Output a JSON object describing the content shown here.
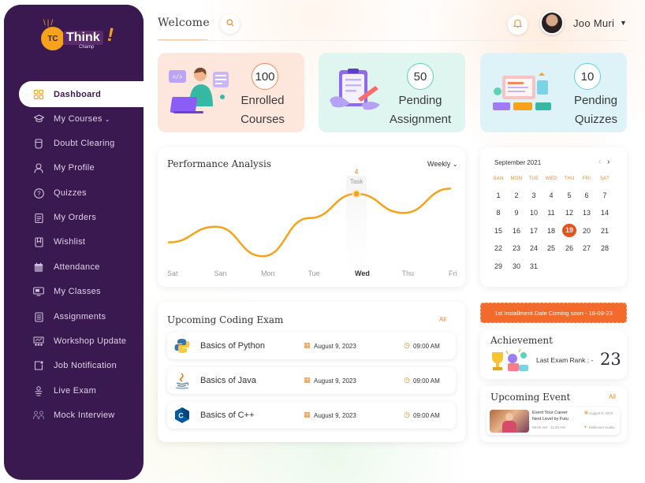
{
  "brand": {
    "logo_badge": "TC",
    "logo_name": "Think",
    "logo_sub": "Champ",
    "logo_mark": "!"
  },
  "sidebar": {
    "items": [
      {
        "label": "Dashboard",
        "icon": "grid-icon",
        "active": true
      },
      {
        "label": "My Courses",
        "icon": "graduation-cap-icon",
        "has_chevron": true
      },
      {
        "label": "Doubt Clearing",
        "icon": "hand-raise-icon"
      },
      {
        "label": "My Profile",
        "icon": "user-icon"
      },
      {
        "label": "Quizzes",
        "icon": "question-circle-icon"
      },
      {
        "label": "My Orders",
        "icon": "clipboard-icon"
      },
      {
        "label": "Wishlist",
        "icon": "bookmark-icon"
      },
      {
        "label": "Attendance",
        "icon": "calendar-icon"
      },
      {
        "label": "My Classes",
        "icon": "monitor-icon"
      },
      {
        "label": "Assignments",
        "icon": "document-icon"
      },
      {
        "label": "Workshop Update",
        "icon": "presentation-icon"
      },
      {
        "label": "Job Notification",
        "icon": "notification-icon"
      },
      {
        "label": "Live Exam",
        "icon": "live-exam-icon"
      },
      {
        "label": "Mock Interview",
        "icon": "interview-icon"
      }
    ]
  },
  "header": {
    "title": "Welcome",
    "user_name": "Joo Muri",
    "icons": [
      "search-icon",
      "bell-icon",
      "caret-down-icon"
    ]
  },
  "stats": [
    {
      "value": "100",
      "line1": "Enrolled",
      "line2": "Courses",
      "bg": "#fde6dc",
      "ring": "#f08a5d"
    },
    {
      "value": "50",
      "line1": "Pending",
      "line2": "Assignment",
      "bg": "#def6ef",
      "ring": "#5ed2b4"
    },
    {
      "value": "10",
      "line1": "Pending",
      "line2": "Quizzes",
      "bg": "#ddf3f8",
      "ring": "#5ed2d6"
    }
  ],
  "performance": {
    "title": "Performance Analysis",
    "period": "Weekly",
    "tooltip_value": "4",
    "tooltip_label": "Task",
    "line_color": "#f6a21a"
  },
  "chart_data": {
    "type": "line",
    "categories": [
      "Sat",
      "San",
      "Mon",
      "Tue",
      "Wed",
      "Thu",
      "Fri"
    ],
    "series": [
      {
        "values": [
          1.2,
          2.1,
          0.4,
          2.6,
          4.0,
          2.9,
          4.3
        ]
      }
    ],
    "ylim": [
      0,
      5
    ],
    "highlight_index": 4,
    "title": "Performance Analysis"
  },
  "calendar": {
    "month_label": "September 2021",
    "weekdays": [
      "SAN",
      "MON",
      "TUE",
      "WED",
      "THU",
      "FRI",
      "SAT"
    ],
    "weeks": [
      [
        "1",
        "2",
        "3",
        "4",
        "5",
        "6",
        "7"
      ],
      [
        "8",
        "9",
        "10",
        "11",
        "12",
        "13",
        "14"
      ],
      [
        "15",
        "16",
        "17",
        "18",
        "19",
        "20",
        "21"
      ],
      [
        "22",
        "23",
        "24",
        "25",
        "26",
        "27",
        "28"
      ],
      [
        "29",
        "30",
        "31",
        "",
        "",
        "",
        ""
      ]
    ],
    "selected_day": "19",
    "accent": "#e8501e"
  },
  "exams": {
    "title": "Upcoming Coding Exam",
    "all_label": "All",
    "rows": [
      {
        "name": "Basics of Python",
        "date": "August 9, 2023",
        "time": "09:00 AM",
        "icon": "python-icon"
      },
      {
        "name": "Basics of Java",
        "date": "August 9, 2023",
        "time": "09:00 AM",
        "icon": "java-icon"
      },
      {
        "name": "Basics of C++",
        "date": "August 9, 2023",
        "time": "09:00 AM",
        "icon": "cpp-icon"
      }
    ]
  },
  "installment": {
    "text": "1st Installment Date Coming soon - 18-09-23"
  },
  "achievement": {
    "title": "Achievement",
    "rank_label": "Last Exam Rank : -",
    "rank_value": "23"
  },
  "event": {
    "title": "Upcoming Event",
    "all_label": "All",
    "line1": "Event Your Career",
    "line2": "Next Level by Futu",
    "time": "09:00 AM - 11:00 AM",
    "date": "August 9, 2023",
    "location": "Millenium Audito"
  }
}
